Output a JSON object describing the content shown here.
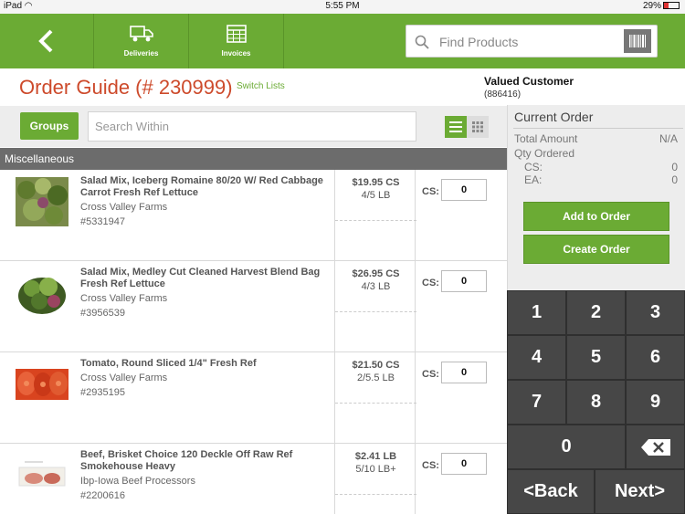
{
  "status": {
    "device": "iPad",
    "time": "5:55 PM",
    "battery": "29%"
  },
  "nav": {
    "deliveries_label": "Deliveries",
    "invoices_label": "Invoices",
    "search_placeholder": "Find Products"
  },
  "header": {
    "title": "Order Guide (# 230999)",
    "switch_lists": "Switch Lists",
    "customer_name": "Valued Customer",
    "customer_id": "(886416)"
  },
  "filter": {
    "groups_label": "Groups",
    "search_placeholder": "Search Within"
  },
  "category": "Miscellaneous",
  "products": [
    {
      "name": "Salad Mix, Iceberg Romaine 80/20 W/ Red Cabbage Carrot Fresh Ref Lettuce",
      "brand": "Cross Valley Farms",
      "number": "#5331947",
      "price": "$19.95 CS",
      "pack": "4/5 LB",
      "qty_label": "CS:",
      "qty": "0"
    },
    {
      "name": "Salad Mix, Medley Cut Cleaned Harvest Blend Bag Fresh Ref Lettuce",
      "brand": "Cross Valley Farms",
      "number": "#3956539",
      "price": "$26.95 CS",
      "pack": "4/3 LB",
      "qty_label": "CS:",
      "qty": "0"
    },
    {
      "name": "Tomato, Round Sliced 1/4\" Fresh Ref",
      "brand": "Cross Valley Farms",
      "number": "#2935195",
      "price": "$21.50 CS",
      "pack": "2/5.5 LB",
      "qty_label": "CS:",
      "qty": "0"
    },
    {
      "name": "Beef, Brisket Choice 120 Deckle Off Raw Ref Smokehouse Heavy",
      "brand": "Ibp-Iowa Beef Processors",
      "number": "#2200616",
      "price": "$2.41 LB",
      "pack": "5/10 LB+",
      "qty_label": "CS:",
      "qty": "0"
    }
  ],
  "current_order": {
    "title": "Current Order",
    "total_label": "Total Amount",
    "total_value": "N/A",
    "qty_label": "Qty Ordered",
    "cs_label": "CS:",
    "cs_value": "0",
    "ea_label": "EA:",
    "ea_value": "0",
    "add_button": "Add to Order",
    "create_button": "Create Order"
  },
  "keypad": {
    "k1": "1",
    "k2": "2",
    "k3": "3",
    "k4": "4",
    "k5": "5",
    "k6": "6",
    "k7": "7",
    "k8": "8",
    "k9": "9",
    "k0": "0",
    "back": "<Back",
    "next": "Next>"
  },
  "colors": {
    "brand_green": "#6bab34",
    "title_red": "#cd4a2b",
    "keypad_bg": "#3e3e3e"
  }
}
